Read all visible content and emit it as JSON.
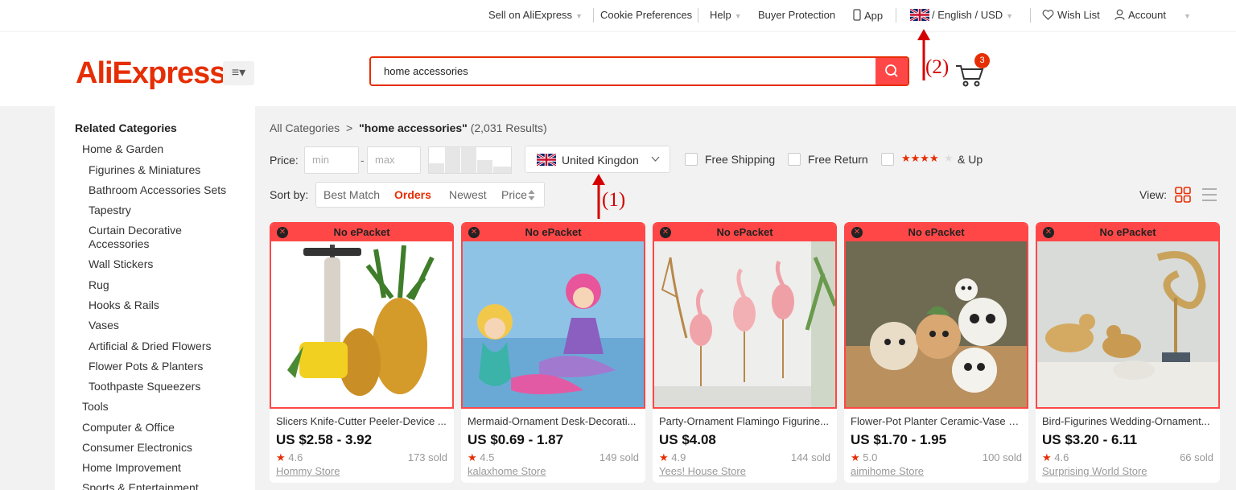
{
  "topbar": {
    "sell": "Sell on AliExpress",
    "cookie": "Cookie Preferences",
    "help": "Help",
    "buyer_protection": "Buyer Protection",
    "app": "App",
    "lang_currency": "/ English / USD",
    "wish_list": "Wish List",
    "account": "Account"
  },
  "header": {
    "logo": "AliExpress",
    "search_value": "home accessories",
    "cart_count": "3"
  },
  "annotations": {
    "one": "(1)",
    "two": "(2)"
  },
  "sidebar": {
    "title": "Related Categories",
    "items": [
      "Home & Garden",
      "Figurines & Miniatures",
      "Bathroom Accessories Sets",
      "Tapestry",
      "Curtain Decorative",
      "Accessories",
      "Wall Stickers",
      "Rug",
      "Hooks & Rails",
      "Vases",
      "Artificial & Dried Flowers",
      "Flower Pots & Planters",
      "Toothpaste Squeezers",
      "Tools",
      "Computer & Office",
      "Consumer Electronics",
      "Home Improvement",
      "Sports & Entertainment"
    ]
  },
  "breadcrumb": {
    "root": "All Categories",
    "sep": ">",
    "query": "\"home accessories\"",
    "count": "(2,031 Results)"
  },
  "filters": {
    "price_label": "Price:",
    "min_placeholder": "min",
    "dash": "-",
    "max_placeholder": "max",
    "ship_from": "United Kingdon",
    "free_shipping": "Free Shipping",
    "free_return": "Free Return",
    "rating_up": "& Up",
    "rating_stars": "★★★★",
    "rating_empty": "★"
  },
  "sort": {
    "label": "Sort by:",
    "best_match": "Best Match",
    "orders": "Orders",
    "newest": "Newest",
    "price": "Price",
    "view_label": "View:"
  },
  "products": [
    {
      "badge": "No ePacket",
      "title": "Slicers Knife-Cutter Peeler-Device ...",
      "price": "US $2.58 - 3.92",
      "rating": "4.6",
      "sold": "173 sold",
      "store": "Hommy Store"
    },
    {
      "badge": "No ePacket",
      "title": "Mermaid-Ornament Desk-Decorati...",
      "price": "US $0.69 - 1.87",
      "rating": "4.5",
      "sold": "149 sold",
      "store": "kalaxhome Store"
    },
    {
      "badge": "No ePacket",
      "title": "Party-Ornament Flamingo Figurine...",
      "price": "US $4.08",
      "rating": "4.9",
      "sold": "144 sold",
      "store": "Yees! House Store"
    },
    {
      "badge": "No ePacket",
      "title": "Flower-Pot Planter Ceramic-Vase D...",
      "price": "US $1.70 - 1.95",
      "rating": "5.0",
      "sold": "100 sold",
      "store": "aimihome Store"
    },
    {
      "badge": "No ePacket",
      "title": "Bird-Figurines Wedding-Ornament...",
      "price": "US $3.20 - 6.11",
      "rating": "4.6",
      "sold": "66 sold",
      "store": "Surprising World Store"
    }
  ],
  "colors": {
    "accent": "#e62e04",
    "badge_red": "#ff4747",
    "annotation": "#d40000"
  }
}
